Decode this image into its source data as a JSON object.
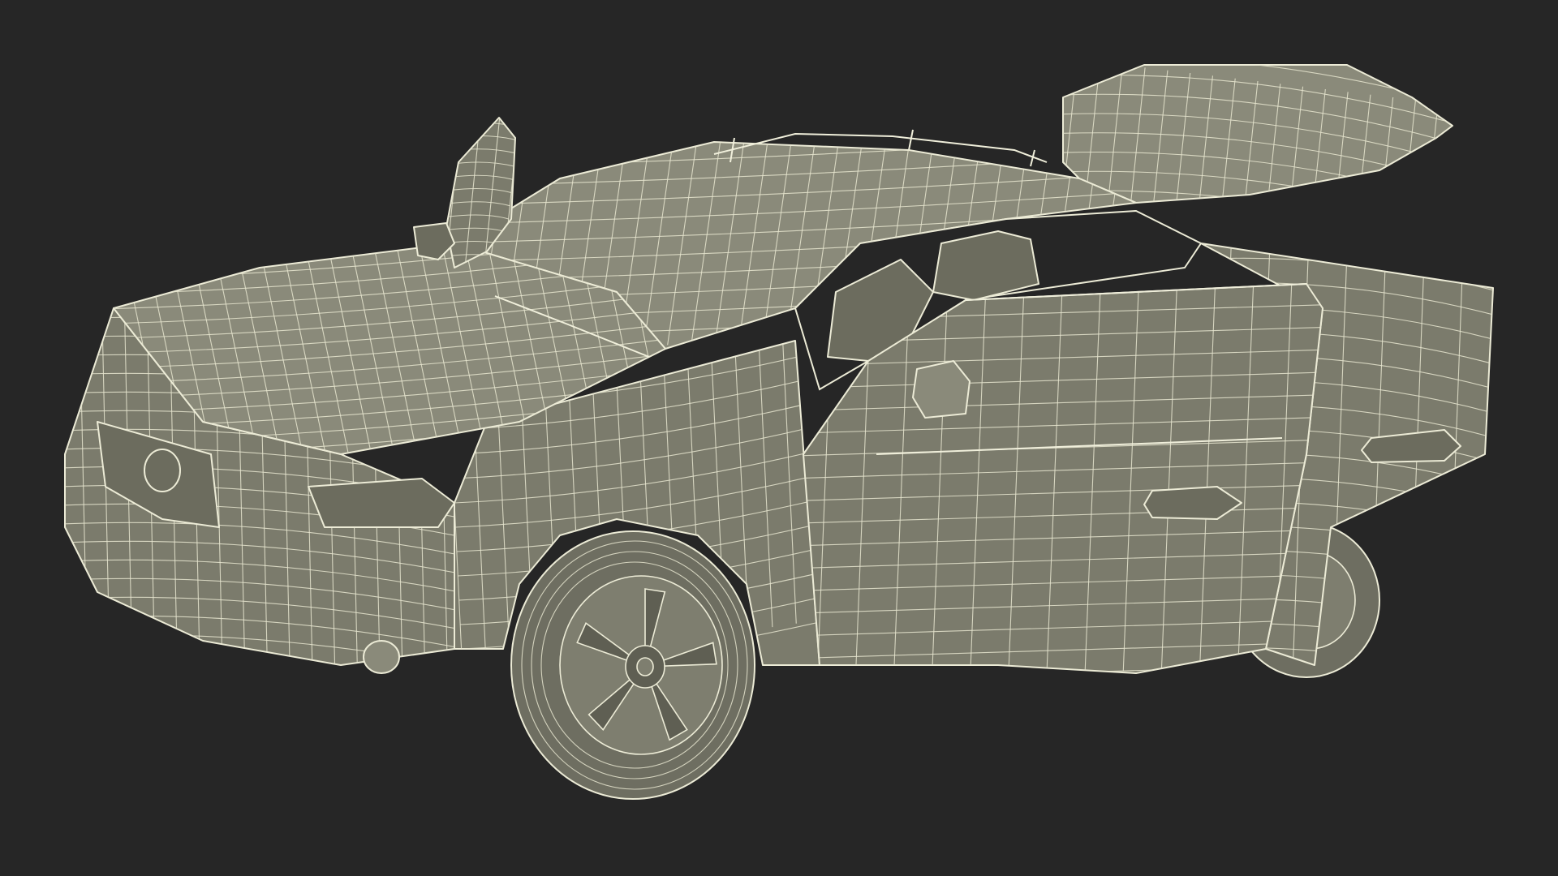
{
  "scene": {
    "background_color": "#262626",
    "model_color": "#7b7b6c",
    "wire_color": "#ecebd6",
    "render_mode": "wireframe-on-shaded",
    "subject": "car-with-open-doors"
  }
}
